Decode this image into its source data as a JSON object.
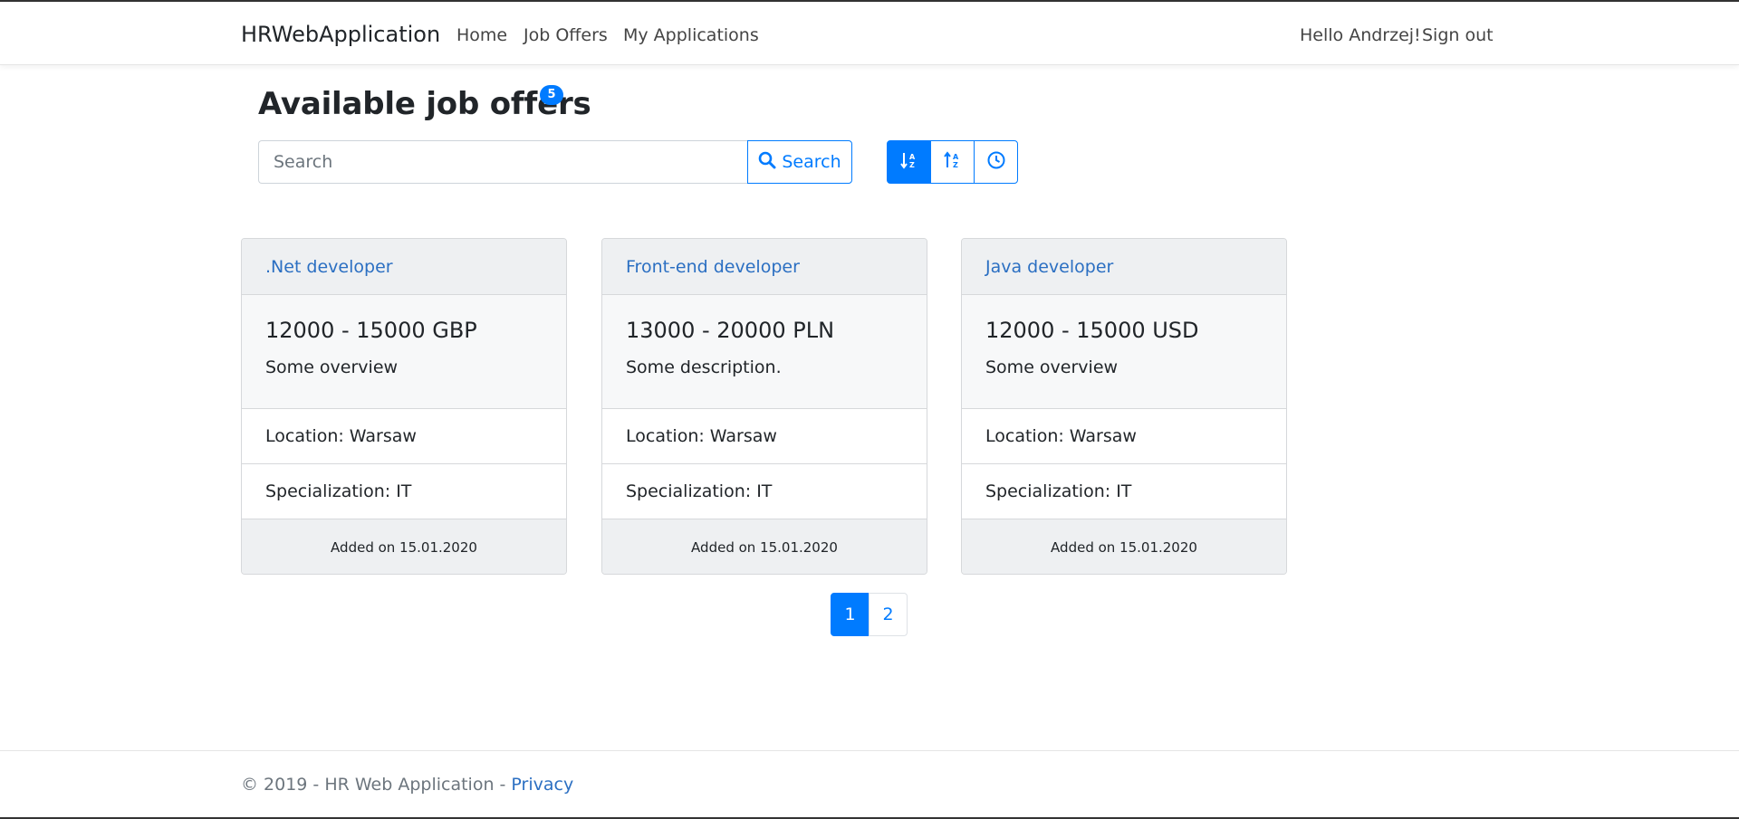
{
  "navbar": {
    "brand": "HRWebApplication",
    "links": {
      "home": "Home",
      "job_offers": "Job Offers",
      "my_applications": "My Applications"
    },
    "greeting": "Hello Andrzej!",
    "sign_out": "Sign out"
  },
  "page": {
    "title": "Available job offers",
    "count": "5"
  },
  "search": {
    "placeholder": "Search",
    "value": "",
    "button_label": "Search"
  },
  "sort": {
    "buttons": [
      {
        "icon": "sort-alpha-down-icon",
        "active": true
      },
      {
        "icon": "sort-alpha-up-icon",
        "active": false
      },
      {
        "icon": "clock-icon",
        "active": false
      }
    ]
  },
  "offers": [
    {
      "title": ".Net developer",
      "salary": "12000 - 15000 GBP",
      "overview": "Some overview",
      "location": "Location: Warsaw",
      "specialization": "Specialization: IT",
      "added": "Added on 15.01.2020"
    },
    {
      "title": "Front-end developer",
      "salary": "13000 - 20000 PLN",
      "overview": "Some description.",
      "location": "Location: Warsaw",
      "specialization": "Specialization: IT",
      "added": "Added on 15.01.2020"
    },
    {
      "title": "Java developer",
      "salary": "12000 - 15000 USD",
      "overview": "Some overview",
      "location": "Location: Warsaw",
      "specialization": "Specialization: IT",
      "added": "Added on 15.01.2020"
    }
  ],
  "pagination": {
    "pages": [
      "1",
      "2"
    ],
    "current": "1"
  },
  "footer": {
    "text": "© 2019 - HR Web Application - ",
    "privacy": "Privacy"
  },
  "colors": {
    "primary": "#007bff",
    "link": "#2b6fc2",
    "card_header_bg": "#eef0f2"
  }
}
